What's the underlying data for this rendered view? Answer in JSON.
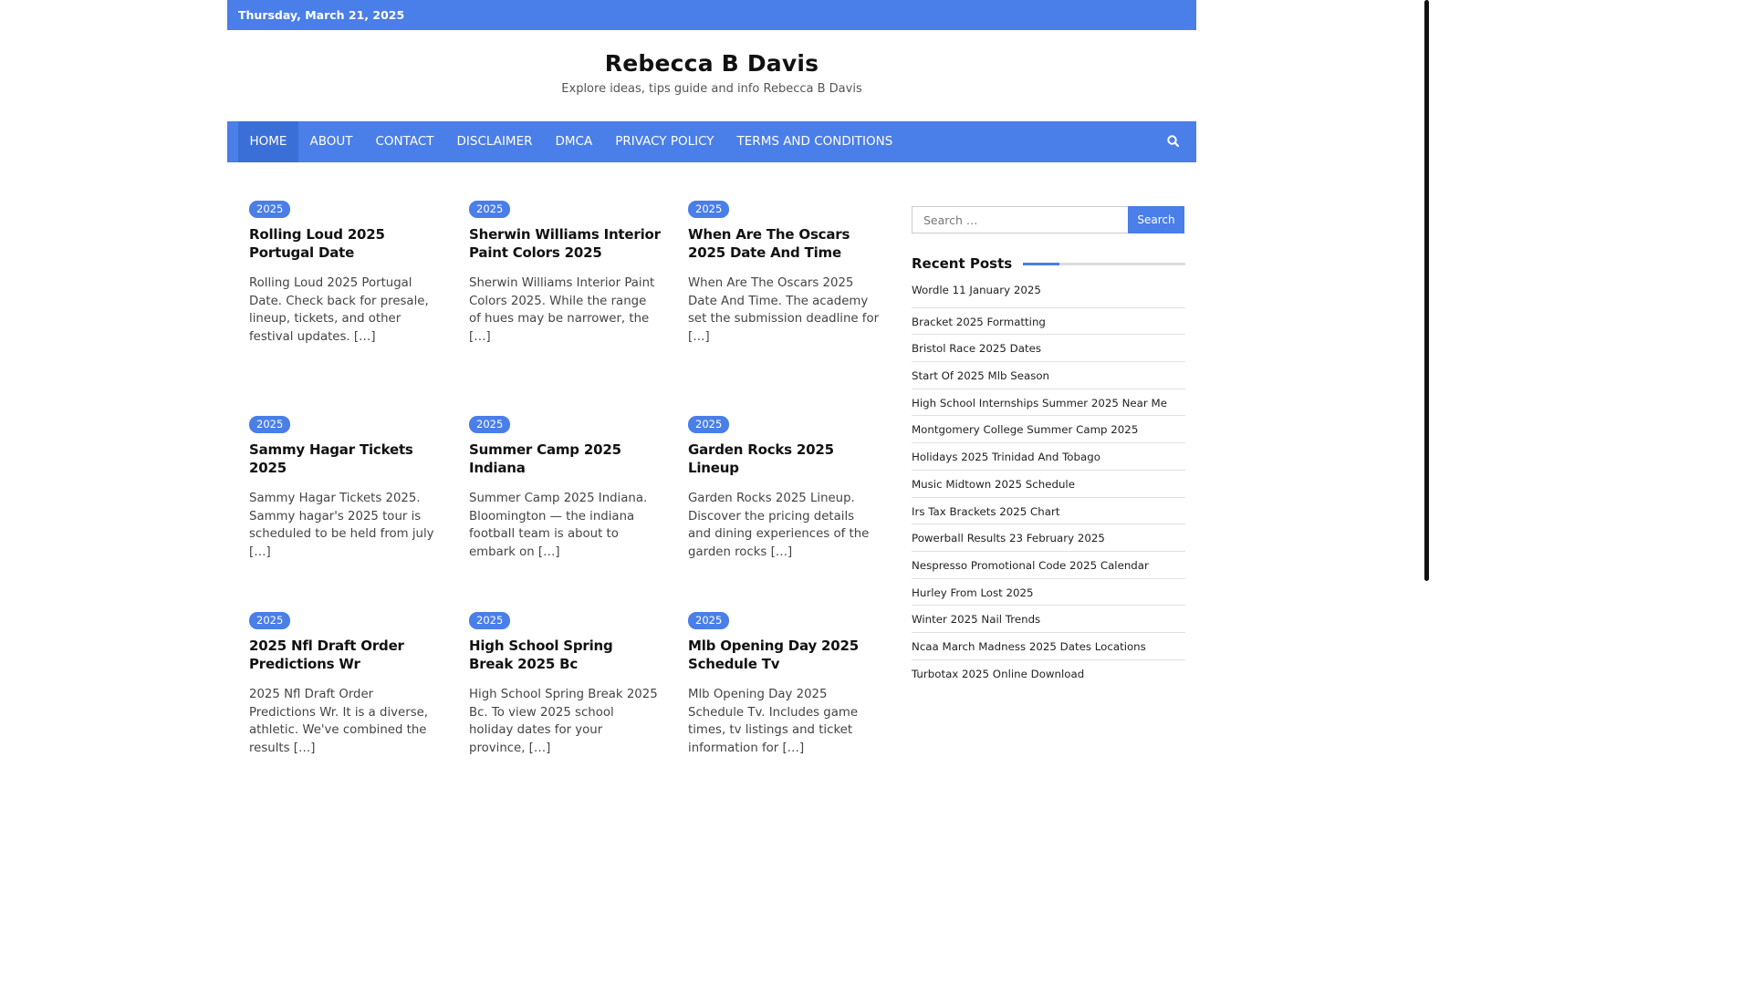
{
  "topbar": {
    "date": "Thursday, March 21, 2025"
  },
  "site": {
    "title": "Rebecca B Davis",
    "description": "Explore ideas, tips guide and info Rebecca B Davis"
  },
  "nav": {
    "items": [
      {
        "label": "HOME",
        "active": true
      },
      {
        "label": "ABOUT"
      },
      {
        "label": "CONTACT"
      },
      {
        "label": "DISCLAIMER"
      },
      {
        "label": "DMCA"
      },
      {
        "label": "PRIVACY POLICY"
      },
      {
        "label": "TERMS AND CONDITIONS"
      }
    ],
    "search_icon": "search-icon"
  },
  "posts": [
    {
      "category": "2025",
      "title": "Rolling Loud 2025 Portugal Date",
      "excerpt": "Rolling Loud 2025 Portugal Date. Check back for presale, lineup, tickets, and other festival updates. […]"
    },
    {
      "category": "2025",
      "title": "Sherwin Williams Interior Paint Colors 2025",
      "excerpt": "Sherwin Williams Interior Paint Colors 2025. While the range of hues may be narrower, the […]"
    },
    {
      "category": "2025",
      "title": "When Are The Oscars 2025 Date And Time",
      "excerpt": "When Are The Oscars 2025 Date And Time. The academy set the submission deadline for […]"
    },
    {
      "category": "2025",
      "title": "Sammy Hagar Tickets 2025",
      "excerpt": "Sammy Hagar Tickets 2025. Sammy hagar's 2025 tour is scheduled to be held from july […]"
    },
    {
      "category": "2025",
      "title": "Summer Camp 2025 Indiana",
      "excerpt": "Summer Camp 2025 Indiana. Bloomington — the indiana football team is about to embark on […]"
    },
    {
      "category": "2025",
      "title": "Garden Rocks 2025 Lineup",
      "excerpt": "Garden Rocks 2025 Lineup. Discover the pricing details and dining experiences of the garden rocks […]"
    },
    {
      "category": "2025",
      "title": "2025 Nfl Draft Order Predictions Wr",
      "excerpt": "2025 Nfl Draft Order Predictions Wr. It is a diverse, athletic. We've combined the results […]"
    },
    {
      "category": "2025",
      "title": "High School Spring Break 2025 Bc",
      "excerpt": "High School Spring Break 2025 Bc. To view 2025 school holiday dates for your province, […]"
    },
    {
      "category": "2025",
      "title": "Mlb Opening Day 2025 Schedule Tv",
      "excerpt": "Mlb Opening Day 2025 Schedule Tv. Includes game times, tv listings and ticket information for […]"
    }
  ],
  "sidebar": {
    "search_placeholder": "Search …",
    "search_button": "Search",
    "recent_title": "Recent Posts",
    "recent_posts": [
      "Wordle 11 January 2025",
      "Bracket 2025 Formatting",
      "Bristol Race 2025 Dates",
      "Start Of 2025 Mlb Season",
      "High School Internships Summer 2025 Near Me",
      "Montgomery College Summer Camp 2025",
      "Holidays 2025 Trinidad And Tobago",
      "Music Midtown 2025 Schedule",
      "Irs Tax Brackets 2025 Chart",
      "Powerball Results 23 February 2025",
      "Nespresso Promotional Code 2025 Calendar",
      "Hurley From Lost 2025",
      "Winter 2025 Nail Trends",
      "Ncaa March Madness 2025 Dates Locations",
      "Turbotax 2025 Online Download"
    ]
  },
  "colors": {
    "accent": "#4a7ee8",
    "accent_dark": "#3b6fd8"
  }
}
